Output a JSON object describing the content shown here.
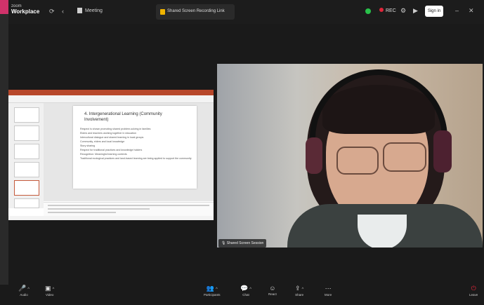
{
  "app": {
    "brand_top": "zoom",
    "brand_name": "Workplace"
  },
  "tabs": [
    {
      "label": "Meeting"
    },
    {
      "label": "Shared Screen Recording Link"
    }
  ],
  "top_controls": {
    "rec_label": "REC",
    "sign_in": "Sign in"
  },
  "slide": {
    "title": "4. Intergenerational Learning (Community Involvement)",
    "bullets": [
      "Respect is shown promoting shared problem-solving in families",
      "Elders and teachers working together in education",
      "Intercultural dialogue and shared learning in local groups",
      "Community, elders and local knowledge",
      "Story sharing",
      "Respect for traditional practices and knowledge holders",
      "Recognition: Meaningful learning contexts",
      "Traditional ecological practices and land-based learning are being applied to support the community"
    ]
  },
  "participant": {
    "name": "Shared Screen Session"
  },
  "toolbar": [
    {
      "name": "mute",
      "label": "Audio"
    },
    {
      "name": "video",
      "label": "Video"
    },
    {
      "name": "participants",
      "label": "Participants"
    },
    {
      "name": "chat",
      "label": "Chat"
    },
    {
      "name": "react",
      "label": "React"
    },
    {
      "name": "share",
      "label": "Share"
    },
    {
      "name": "more",
      "label": "More"
    },
    {
      "name": "leave",
      "label": "Leave"
    }
  ],
  "colors": {
    "accent_green": "#29c14a",
    "record_red": "#e0263a",
    "ppt_orange": "#b7472a"
  }
}
